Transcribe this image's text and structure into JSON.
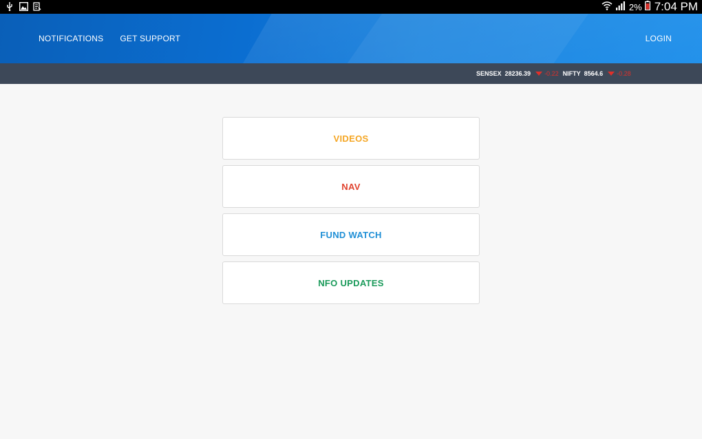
{
  "status_bar": {
    "left_icons": [
      "usb-icon",
      "image-icon",
      "clipboard-icon"
    ],
    "right_icons": [
      "wifi-icon",
      "signal-icon",
      "battery-icon"
    ],
    "battery_percent": "2%",
    "time": "7:04 PM"
  },
  "header": {
    "nav_left": [
      {
        "label": "NOTIFICATIONS"
      },
      {
        "label": "GET SUPPORT"
      }
    ],
    "login_label": "LOGIN"
  },
  "ticker": {
    "items": [
      {
        "name": "SENSEX",
        "value": "28236.39",
        "change": "-0.22",
        "direction": "down"
      },
      {
        "name": "NIFTY",
        "value": "8564.6",
        "change": "-0.28",
        "direction": "down"
      }
    ],
    "down_color": "#e0302a"
  },
  "menu": {
    "items": [
      {
        "label": "VIDEOS",
        "color": "#f5a623"
      },
      {
        "label": "NAV",
        "color": "#e0432f"
      },
      {
        "label": "FUND WATCH",
        "color": "#1f8fd6"
      },
      {
        "label": "NFO UPDATES",
        "color": "#1a9a5a"
      }
    ]
  },
  "colors": {
    "header_blue": "#0b6ed1",
    "ticker_bg": "#3d4858",
    "page_bg": "#f7f7f7"
  }
}
